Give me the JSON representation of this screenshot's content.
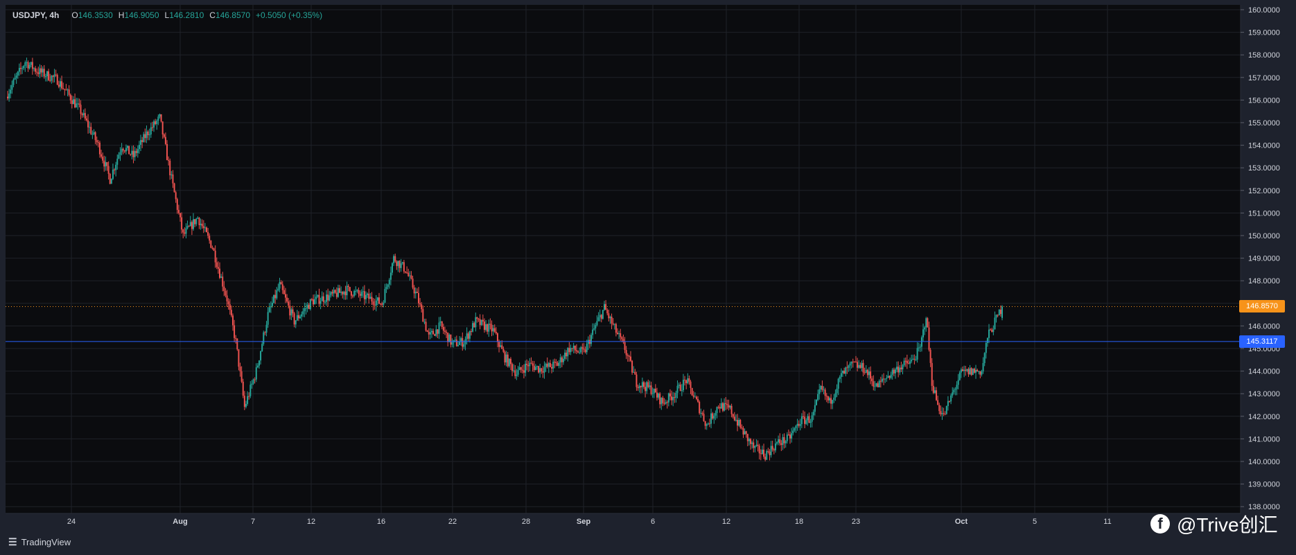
{
  "header": {
    "symbol": "USDJPY",
    "interval": "4h",
    "open_label": "O",
    "open": "146.3530",
    "high_label": "H",
    "high": "146.9050",
    "low_label": "L",
    "low": "146.2810",
    "close_label": "C",
    "close": "146.8570",
    "change": "+0.5050 (+0.35%)"
  },
  "branding": {
    "tradingview": "TradingView",
    "watermark": "@Trive创汇"
  },
  "colors": {
    "up": "#26a69a",
    "down": "#ef5350",
    "background": "#0b0c0f",
    "grid": "#1f2229",
    "current_price": "#f7931a",
    "horizontal_line": "#2962ff"
  },
  "chart_data": {
    "type": "candlestick",
    "title": "USDJPY, 4h",
    "ylim": [
      137.6,
      160.0
    ],
    "y_ticks": [
      "160.0000",
      "159.0000",
      "158.0000",
      "157.0000",
      "156.0000",
      "155.0000",
      "154.0000",
      "153.0000",
      "152.0000",
      "151.0000",
      "150.0000",
      "149.0000",
      "148.0000",
      "147.0000",
      "146.0000",
      "145.0000",
      "144.0000",
      "143.0000",
      "142.0000",
      "141.0000",
      "140.0000",
      "139.0000",
      "138.0000"
    ],
    "x_ticks": [
      "24",
      "Aug",
      "7",
      "12",
      "16",
      "22",
      "28",
      "Sep",
      "6",
      "12",
      "18",
      "23",
      "Oct",
      "5",
      "11"
    ],
    "current_price": {
      "label": "146.8570",
      "value": 146.857
    },
    "horizontal_line": {
      "label": "145.3117",
      "value": 145.3117
    },
    "close_path": [
      [
        0,
        156.3
      ],
      [
        12,
        157.7
      ],
      [
        20,
        157.3
      ],
      [
        34,
        156.9
      ],
      [
        50,
        155.5
      ],
      [
        62,
        154.0
      ],
      [
        70,
        152.5
      ],
      [
        78,
        154.0
      ],
      [
        86,
        153.5
      ],
      [
        95,
        154.5
      ],
      [
        104,
        155.2
      ],
      [
        112,
        152.5
      ],
      [
        120,
        150.0
      ],
      [
        130,
        150.8
      ],
      [
        140,
        149.5
      ],
      [
        150,
        147.2
      ],
      [
        156,
        145.3
      ],
      [
        162,
        142.4
      ],
      [
        170,
        144.0
      ],
      [
        178,
        146.5
      ],
      [
        186,
        147.8
      ],
      [
        196,
        146.2
      ],
      [
        208,
        147.1
      ],
      [
        220,
        147.3
      ],
      [
        232,
        147.6
      ],
      [
        244,
        147.3
      ],
      [
        256,
        147.0
      ],
      [
        264,
        149.0
      ],
      [
        272,
        148.5
      ],
      [
        280,
        147.3
      ],
      [
        288,
        145.5
      ],
      [
        296,
        146.0
      ],
      [
        304,
        145.2
      ],
      [
        312,
        145.3
      ],
      [
        320,
        146.2
      ],
      [
        332,
        145.8
      ],
      [
        340,
        144.6
      ],
      [
        348,
        143.9
      ],
      [
        356,
        144.3
      ],
      [
        364,
        144.1
      ],
      [
        376,
        144.3
      ],
      [
        384,
        145.0
      ],
      [
        394,
        144.8
      ],
      [
        402,
        146.0
      ],
      [
        408,
        146.8
      ],
      [
        414,
        146.0
      ],
      [
        422,
        145.0
      ],
      [
        430,
        143.5
      ],
      [
        440,
        143.2
      ],
      [
        448,
        142.6
      ],
      [
        456,
        143.0
      ],
      [
        464,
        143.6
      ],
      [
        472,
        142.5
      ],
      [
        478,
        141.6
      ],
      [
        486,
        142.5
      ],
      [
        494,
        142.3
      ],
      [
        502,
        141.4
      ],
      [
        510,
        140.6
      ],
      [
        518,
        140.3
      ],
      [
        526,
        140.8
      ],
      [
        534,
        141.0
      ],
      [
        542,
        141.8
      ],
      [
        550,
        141.9
      ],
      [
        556,
        143.2
      ],
      [
        562,
        142.6
      ],
      [
        570,
        143.8
      ],
      [
        578,
        144.3
      ],
      [
        586,
        144.1
      ],
      [
        594,
        143.3
      ],
      [
        602,
        143.8
      ],
      [
        610,
        144.2
      ],
      [
        618,
        144.4
      ],
      [
        624,
        145.0
      ],
      [
        628,
        146.5
      ],
      [
        632,
        143.5
      ],
      [
        636,
        142.5
      ],
      [
        640,
        142.0
      ],
      [
        646,
        143.0
      ],
      [
        652,
        143.9
      ],
      [
        660,
        144.0
      ],
      [
        666,
        144.0
      ],
      [
        670,
        145.5
      ],
      [
        676,
        146.3
      ],
      [
        680,
        146.857
      ]
    ]
  }
}
